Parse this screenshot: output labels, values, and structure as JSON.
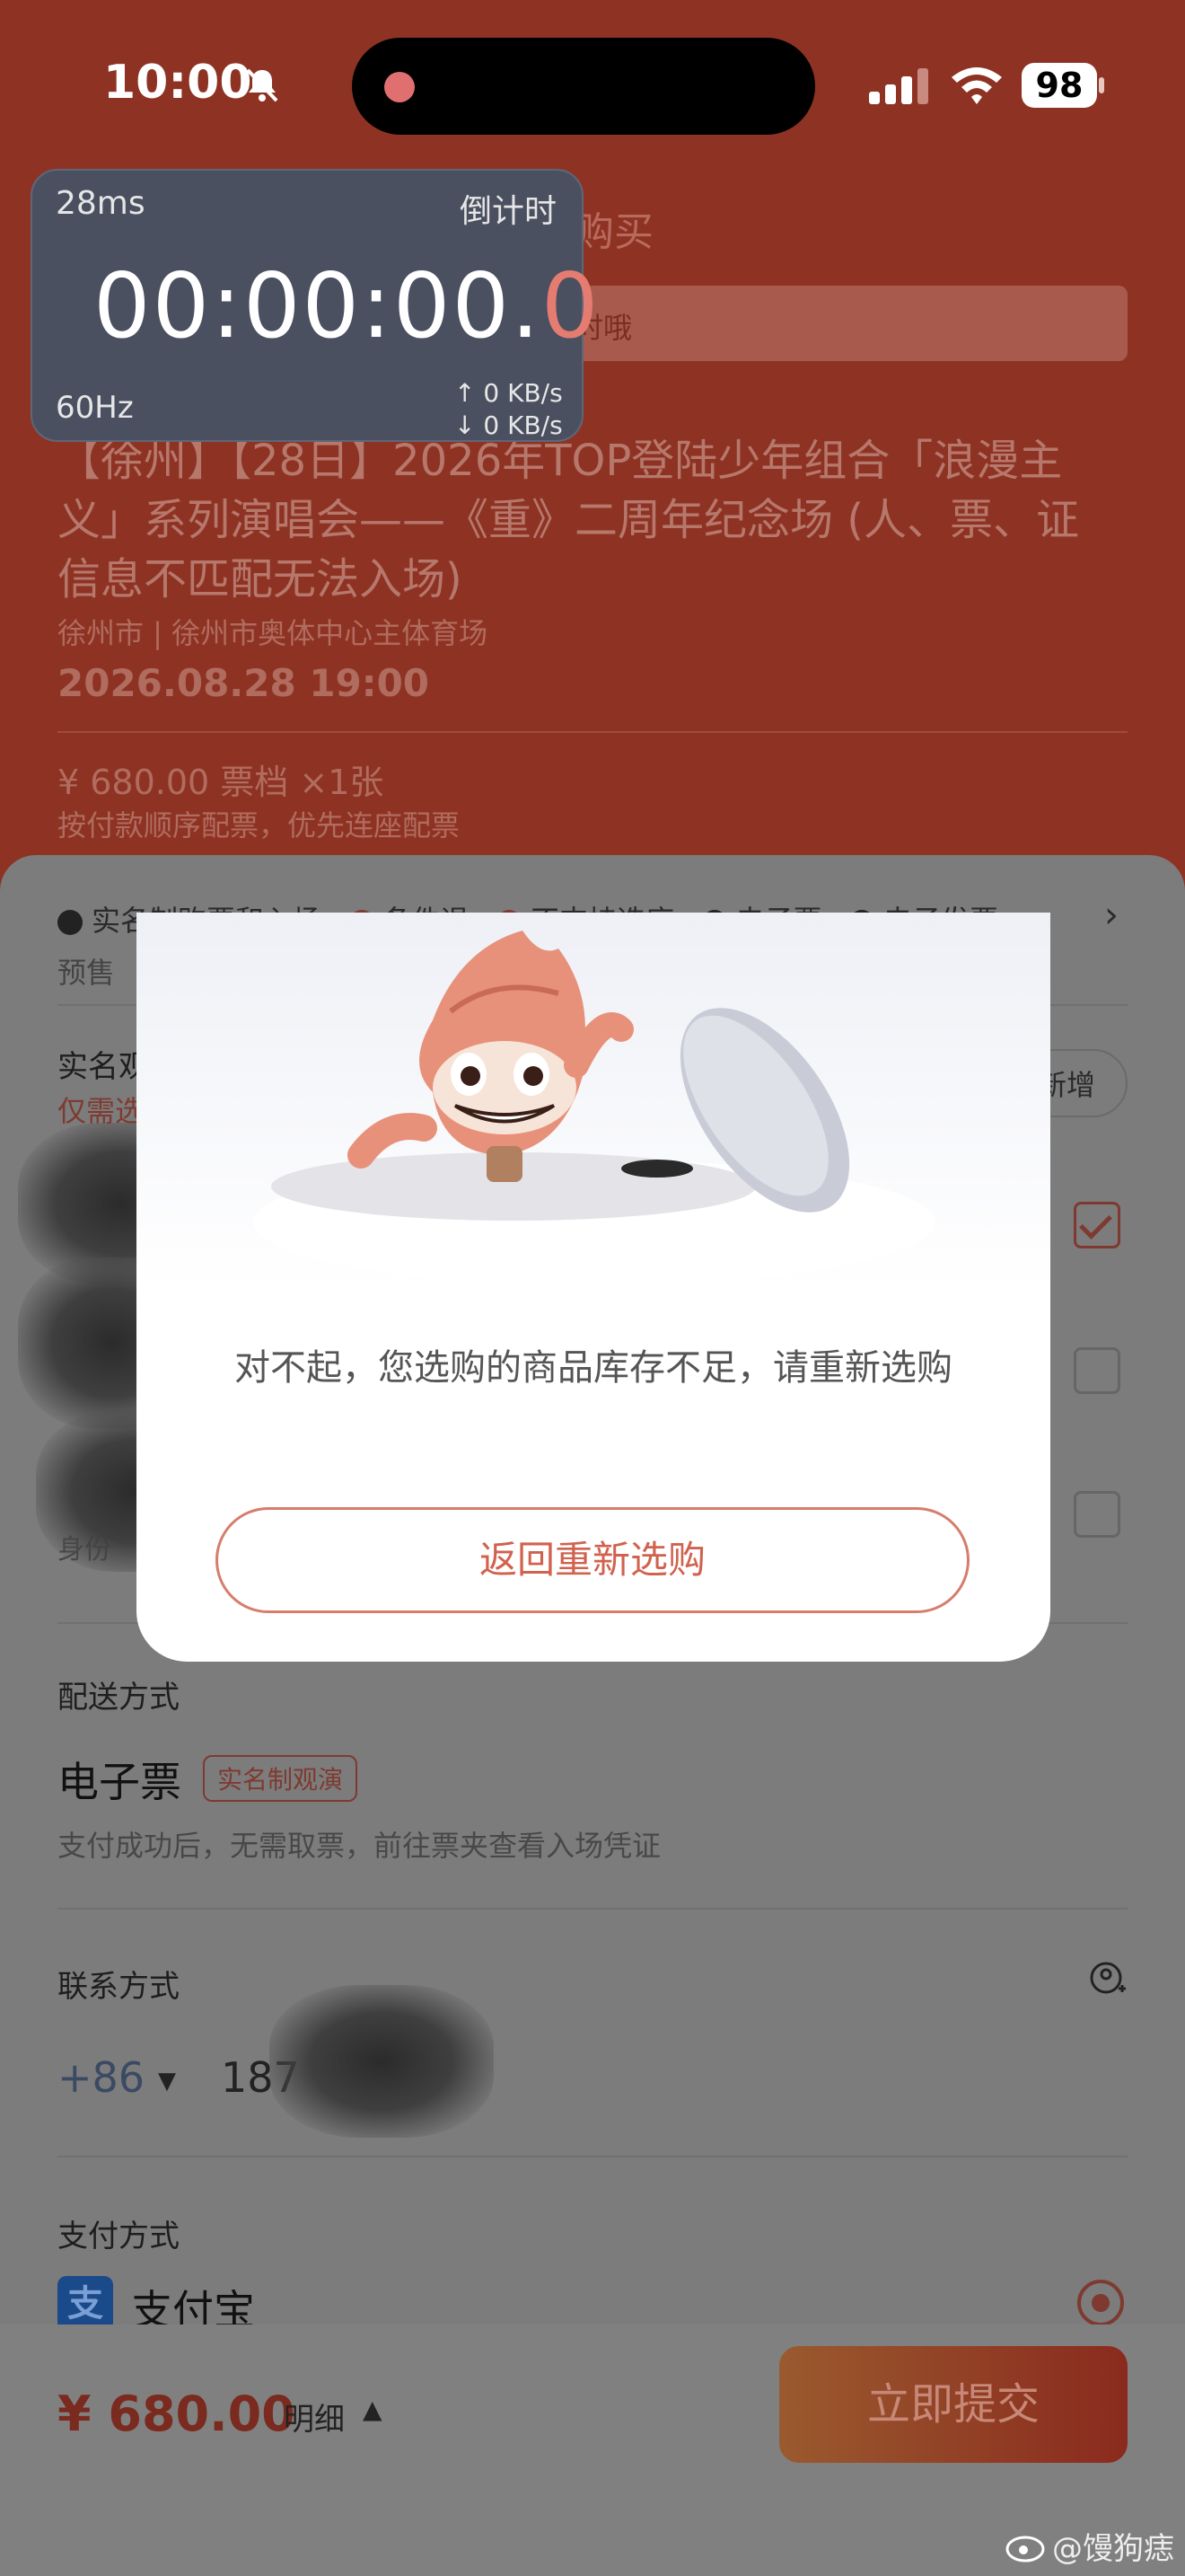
{
  "status_bar": {
    "time": "10:00",
    "battery": "98"
  },
  "header": {
    "title": "购买",
    "notice": "时哦",
    "event_title": "【徐州】【28日】2026年TOP登陆少年组合「浪漫主义」系列演唱会——《重》二周年纪念场 (人、票、证信息不匹配无法入场)",
    "venue": "徐州市 | 徐州市奥体中心主体育场",
    "datetime": "2026.08.28 19:00",
    "price_tier": "¥ 680.00 票档 ×1张",
    "seat_rule": "按付款顺序配票，优先连座配票"
  },
  "timer": {
    "latency": "28ms",
    "mode": "倒计时",
    "time_main": "00:00:00.",
    "time_last": "0",
    "refresh": "60Hz",
    "upload": "↑ 0 KB/s",
    "download": "↓ 0 KB/s"
  },
  "tags": {
    "items": [
      "实名制购票和入场",
      "条件退",
      "不支持选座",
      "电子票",
      "电子发票"
    ],
    "presale": "预售"
  },
  "realname": {
    "title": "实名观",
    "hint": "仅需选",
    "add_label": "新增",
    "id_label": "身份"
  },
  "delivery": {
    "title": "配送方式",
    "method": "电子票",
    "badge": "实名制观演",
    "desc": "支付成功后，无需取票，前往票夹查看入场凭证"
  },
  "contact": {
    "title": "联系方式",
    "country_code": "+86",
    "phone": "187"
  },
  "payment": {
    "title": "支付方式",
    "icon_glyph": "支",
    "method": "支付宝"
  },
  "bottom": {
    "total": "¥ 680.00",
    "detail": "明细",
    "submit": "立即提交"
  },
  "modal": {
    "message": "对不起，您选购的商品库存不足，请重新选购",
    "button": "返回重新选购"
  },
  "watermark": "@馒狗痣",
  "colors": {
    "brand_red": "#d0624e",
    "header_bg": "#8e3324"
  }
}
